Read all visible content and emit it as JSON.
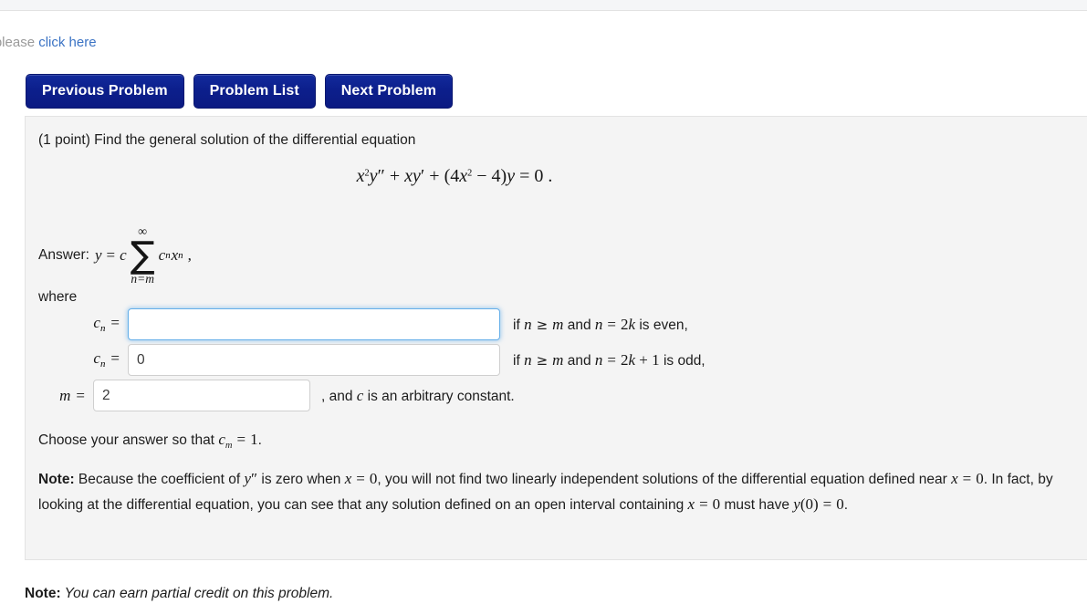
{
  "page": {
    "notice_prefix": "et, please ",
    "notice_link": "click here"
  },
  "nav": {
    "buttons": [
      {
        "label": "Previous Problem",
        "name": "previous-problem-button"
      },
      {
        "label": "Problem List",
        "name": "problem-list-button"
      },
      {
        "label": "Next Problem",
        "name": "next-problem-button"
      }
    ]
  },
  "problem": {
    "points_prompt": "(1 point) Find the general solution of the differential equation",
    "equation": {
      "term1_base": "x",
      "term1_exp": "2",
      "term1_fn": "y",
      "term1_primes": "″",
      "plus1": " + ",
      "term2_x": "x",
      "term2_y": "y",
      "term2_prime": "′",
      "plus2": " + ",
      "paren_open": "(",
      "term3_coef": "4",
      "term3_x": "x",
      "term3_exp": "2",
      "minus": " − ",
      "term3_const": "4",
      "paren_close": ")",
      "term4_y": "y",
      "equals": " = ",
      "rhs": "0",
      "period": " ."
    },
    "answer": {
      "label": "Answer:",
      "y": "y",
      "equals": "=",
      "c": "c",
      "sum_symbol": "∑",
      "sum_upper": "∞",
      "sum_lower": "n=m",
      "coef_c": "c",
      "coef_sub": "n",
      "var_x": "x",
      "var_exp": "n",
      "trailing_comma": ","
    },
    "where_label": "where",
    "rows": [
      {
        "lhs_c": "c",
        "lhs_sub": "n",
        "lhs_eq": "=",
        "input_value": "",
        "input_name": "cn-even-input",
        "focused": true,
        "condition_if": "if ",
        "condition_n": "n",
        "condition_geq": "≥",
        "condition_m": "m",
        "condition_and": " and ",
        "condition_n2": "n",
        "condition_eq": "=",
        "condition_rhs_num": "2",
        "condition_rhs_k": "k",
        "condition_tail": " is even,"
      },
      {
        "lhs_c": "c",
        "lhs_sub": "n",
        "lhs_eq": "=",
        "input_value": "0",
        "input_name": "cn-odd-input",
        "focused": false,
        "condition_if": "if ",
        "condition_n": "n",
        "condition_geq": "≥",
        "condition_m": "m",
        "condition_and": " and ",
        "condition_n2": "n",
        "condition_eq": "=",
        "condition_rhs_num": "2",
        "condition_rhs_k": "k",
        "condition_rhs_plus": " + 1",
        "condition_tail": " is odd,"
      }
    ],
    "m_row": {
      "lhs_m": "m",
      "lhs_eq": "=",
      "input_value": "2",
      "input_name": "m-input",
      "tail_comma": ", and ",
      "tail_c": "c",
      "tail_text": " is an arbitrary constant."
    },
    "choose_line": {
      "prefix": "Choose your answer so that ",
      "c": "c",
      "sub": "m",
      "equals": "=",
      "value": "1",
      "period": "."
    },
    "note": {
      "label": "Note:",
      "part1": " Because the coefficient of ",
      "y": "y",
      "primes": "″",
      "part2": " is zero when ",
      "x1": "x",
      "eq1": "=",
      "zero1": "0",
      "part3": ", you will not find two linearly independent solutions of the differential equation defined near ",
      "x2": "x",
      "eq2": "=",
      "zero2": "0",
      "part4": ". In fact, by looking at the differential equation, you can see that any solution defined on an open interval containing ",
      "x3": "x",
      "eq3": "=",
      "zero3": "0",
      "part5": " must have ",
      "y0": "y",
      "y0_arg": "(0)",
      "eq4": "=",
      "zero4": "0",
      "part6": "."
    }
  },
  "footer": {
    "note_label": "Note:",
    "note_text": " You can earn partial credit on this problem."
  },
  "colors": {
    "button_blue": "#0e2194",
    "link_blue": "#3b73c4",
    "panel_bg": "#f4f4f4",
    "focus_blue": "#66afe9"
  }
}
